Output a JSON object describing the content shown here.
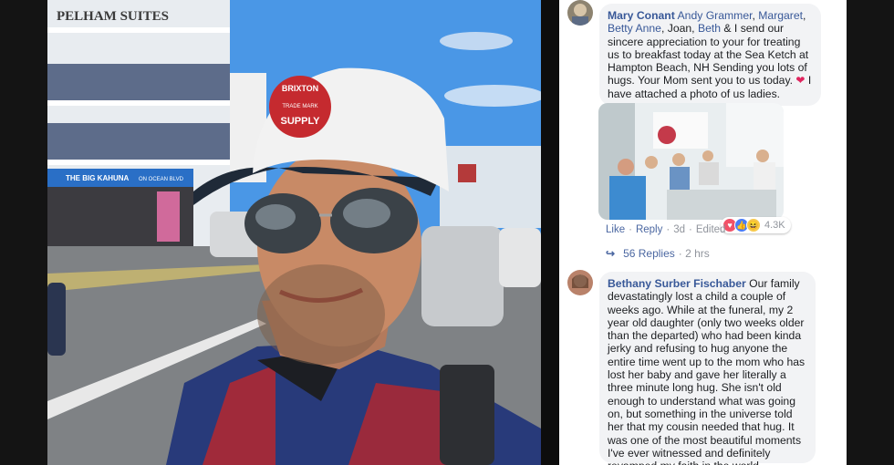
{
  "photo": {
    "hotel_sign": "PELHAM SUITES",
    "shop_sign": "THE BIG KAHUNA",
    "shop_sign2": "ON OCEAN BLVD",
    "cap_patch_top": "BRIXTON",
    "cap_patch_mid": "TRADE MARK",
    "cap_patch_bottom": "SUPPLY"
  },
  "comment1": {
    "author": "Mary Conant",
    "tag1": "Andy Grammer",
    "sep1": ",",
    "tag2": "Margaret",
    "sep2": ",",
    "tag3": "Betty Anne",
    "mid": ", Joan, ",
    "tag4": "Beth",
    "text": " & I send our sincere appreciation to your for treating us to breakfast today at the Sea Ketch at Hampton Beach, NH Sending you lots of hugs. Your Mom sent you to us today. ",
    "heart": "❤",
    "text_end": " I have attached a photo of us ladies.",
    "like": "Like",
    "dot": "·",
    "reply": "Reply",
    "time": "3d",
    "edited": "Edited",
    "reaction_count": "4.3K",
    "replies_label": "56 Replies",
    "replies_time": "· 2 hrs"
  },
  "comment2": {
    "author": "Bethany Surber Fischaber",
    "text": " Our family devastatingly lost a child a couple of weeks ago. While at the funeral, my 2 year old daughter (only two weeks older than the departed) who had been kinda jerky and refusing to hug anyone the entire time went up to the mom who has lost her baby and gave her literally a three minute long hug. She isn't old enough to understand what was going on, but something in the universe told her that my cousin needed that hug. It was one of the most beautiful moments I've ever witnessed and definitely revamped my faith in the world."
  },
  "icons": {
    "replies_arrow": "↪",
    "react_like": "👍",
    "react_haha": "😆"
  }
}
